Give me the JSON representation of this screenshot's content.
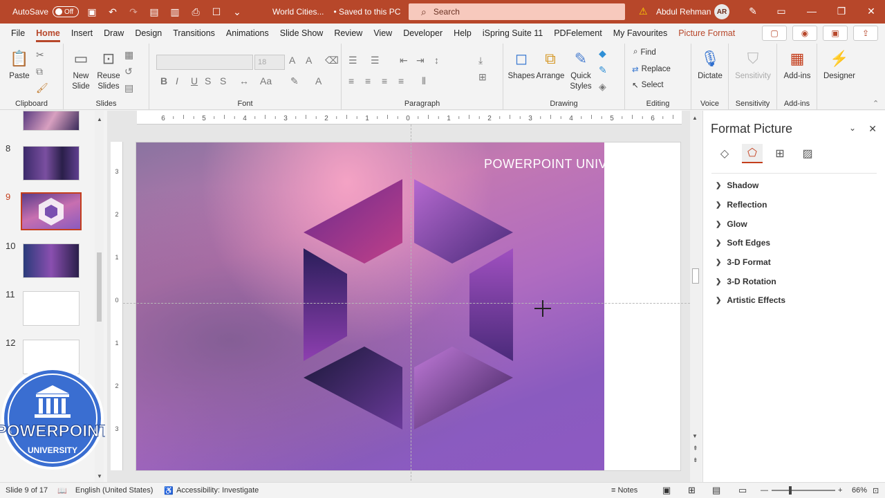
{
  "titlebar": {
    "autosave_label": "AutoSave",
    "autosave_state": "Off",
    "file_name": "World Cities...",
    "save_status": "• Saved to this PC",
    "search_placeholder": "Search",
    "user_name": "Abdul Rehman",
    "user_initials": "AR"
  },
  "menu": {
    "tabs": [
      "File",
      "Home",
      "Insert",
      "Draw",
      "Design",
      "Transitions",
      "Animations",
      "Slide Show",
      "Review",
      "View",
      "Developer",
      "Help",
      "iSpring Suite 11",
      "PDFelement",
      "My Favourites"
    ],
    "active_tab": "Home",
    "context_tab": "Picture Format"
  },
  "ribbon": {
    "clipboard": {
      "paste": "Paste",
      "label": "Clipboard"
    },
    "slides": {
      "new_slide_1": "New",
      "new_slide_2": "Slide",
      "reuse_1": "Reuse",
      "reuse_2": "Slides",
      "label": "Slides"
    },
    "font": {
      "font_size": "18",
      "bold": "B",
      "italic": "I",
      "underline": "U",
      "strike": "S",
      "label": "Font"
    },
    "paragraph": {
      "label": "Paragraph"
    },
    "drawing": {
      "shapes": "Shapes",
      "arrange": "Arrange",
      "quick_styles_1": "Quick",
      "quick_styles_2": "Styles",
      "label": "Drawing"
    },
    "editing": {
      "find": "Find",
      "replace": "Replace",
      "select": "Select",
      "label": "Editing"
    },
    "voice": {
      "dictate": "Dictate",
      "label": "Voice"
    },
    "sensitivity": {
      "button": "Sensitivity",
      "label": "Sensitivity"
    },
    "addins": {
      "button": "Add-ins",
      "label": "Add-ins"
    },
    "designer": {
      "button": "Designer"
    }
  },
  "slides_pane": {
    "numbers": [
      "8",
      "9",
      "10",
      "11",
      "12"
    ],
    "selected": "9"
  },
  "slide": {
    "heading": "POWERPOINT UNIVERSITY"
  },
  "ruler": {
    "h_ticks": [
      "6",
      "5",
      "4",
      "3",
      "2",
      "1",
      "0",
      "1",
      "2",
      "3",
      "4",
      "5",
      "6"
    ],
    "v_ticks": [
      "3",
      "2",
      "1",
      "0",
      "1",
      "2",
      "3"
    ]
  },
  "logo": {
    "top": "POWERPOINT",
    "bottom": "UNIVERSITY"
  },
  "format_pane": {
    "title": "Format Picture",
    "sections": [
      "Shadow",
      "Reflection",
      "Glow",
      "Soft Edges",
      "3-D Format",
      "3-D Rotation",
      "Artistic Effects"
    ]
  },
  "status": {
    "slide_info": "Slide 9 of 17",
    "language": "English (United States)",
    "accessibility": "Accessibility: Investigate",
    "notes": "Notes",
    "zoom": "66%"
  },
  "colors": {
    "accent": "#b7472a",
    "selection": "#c43e1c"
  }
}
